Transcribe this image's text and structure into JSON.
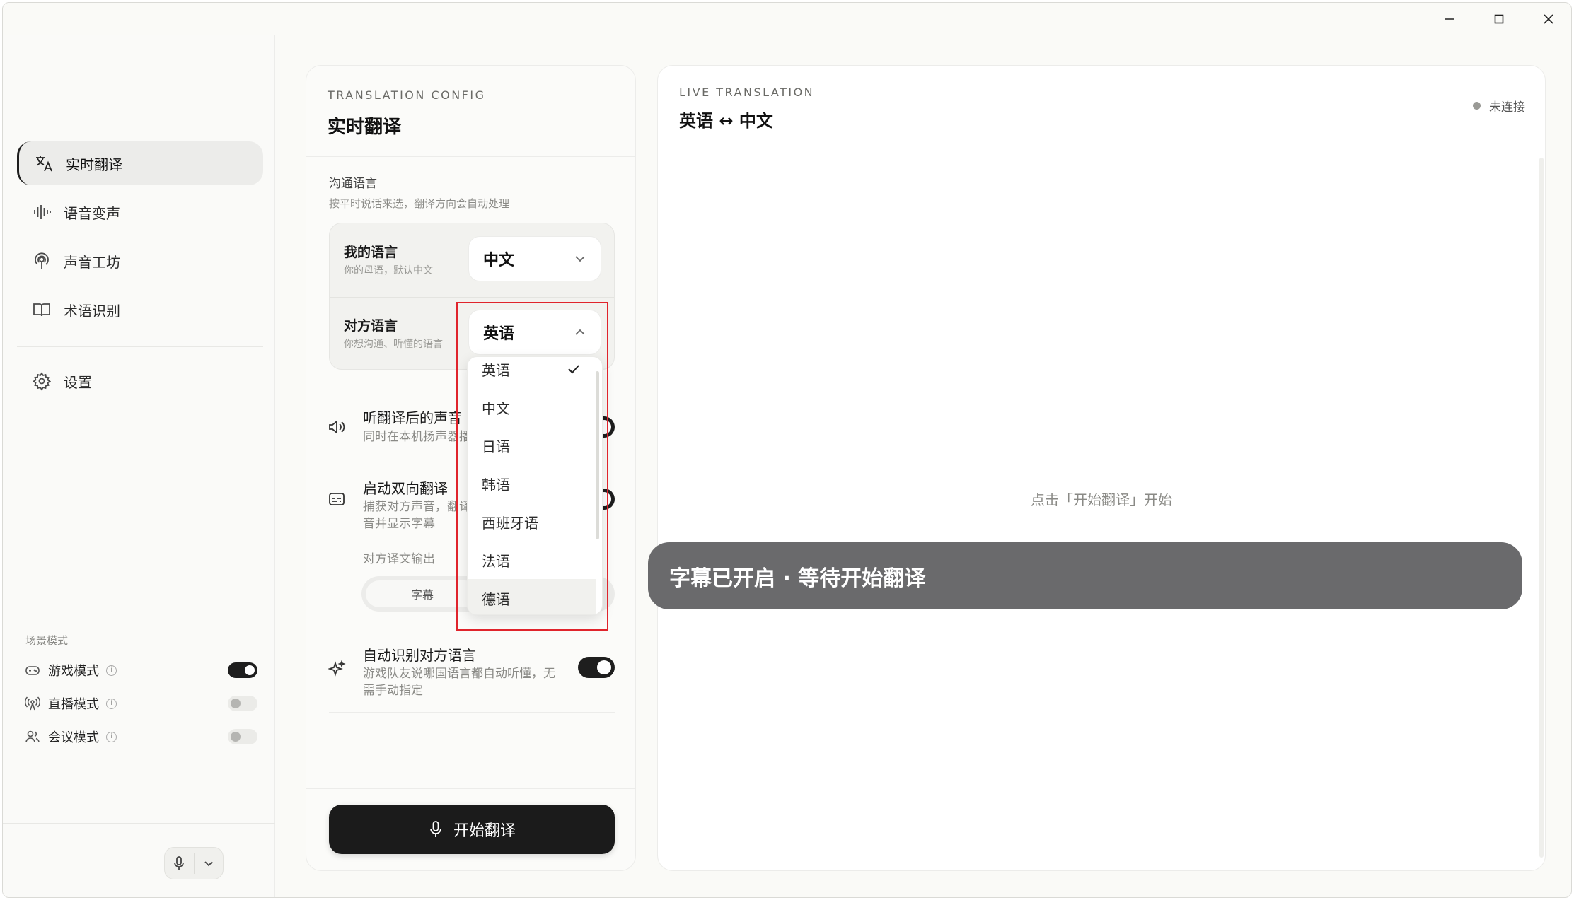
{
  "window": {
    "controls": [
      "minimize",
      "maximize",
      "close"
    ]
  },
  "sidebar": {
    "nav": [
      {
        "label": "实时翻译",
        "icon": "translate-icon",
        "active": true
      },
      {
        "label": "语音变声",
        "icon": "waveform-icon",
        "active": false
      },
      {
        "label": "声音工坊",
        "icon": "podcast-icon",
        "active": false
      },
      {
        "label": "术语识别",
        "icon": "book-icon",
        "active": false
      }
    ],
    "settings_label": "设置",
    "scene": {
      "title": "场景模式",
      "items": [
        {
          "label": "游戏模式",
          "icon": "gamepad-icon",
          "on": true
        },
        {
          "label": "直播模式",
          "icon": "broadcast-icon",
          "on": false
        },
        {
          "label": "会议模式",
          "icon": "users-icon",
          "on": false
        }
      ],
      "info_glyph": "i"
    }
  },
  "config": {
    "eyebrow": "TRANSLATION CONFIG",
    "title": "实时翻译",
    "section_label": "沟通语言",
    "section_sub": "按平时说话来选，翻译方向会自动处理",
    "my_lang": {
      "label": "我的语言",
      "hint": "你的母语，默认中文",
      "value": "中文"
    },
    "their_lang": {
      "label": "对方语言",
      "hint": "你想沟通、听懂的语言",
      "value": "英语"
    },
    "listen": {
      "title": "听翻译后的声音",
      "sub": "同时在本机扬声器播放"
    },
    "duplex": {
      "title": "启动双向翻译",
      "sub_line1": "捕获对方声音，翻译",
      "sub_line2": "音并显示字幕"
    },
    "output_label": "对方译文输出",
    "output_option": "字幕",
    "auto_detect": {
      "title": "自动识别对方语言",
      "sub_line1": "游戏队友说哪国语言都自动听懂，无",
      "sub_line2": "需手动指定"
    },
    "start_label": "开始翻译"
  },
  "dropdown": {
    "options": [
      "英语",
      "中文",
      "日语",
      "韩语",
      "西班牙语",
      "法语",
      "德语"
    ],
    "selected": "英语",
    "hovered": "德语"
  },
  "live": {
    "eyebrow": "LIVE TRANSLATION",
    "title": "英语 ↔ 中文",
    "status": "未连接",
    "hint": "点击「开始翻译」开始",
    "toast": "字幕已开启 · 等待开始翻译"
  }
}
